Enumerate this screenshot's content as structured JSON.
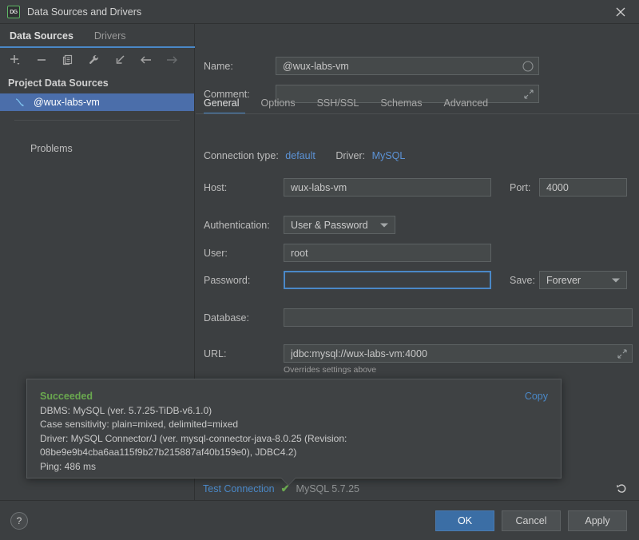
{
  "window": {
    "title": "Data Sources and Drivers",
    "app_icon": "DG",
    "close_label": "✕"
  },
  "left_panel": {
    "tabs": [
      {
        "label": "Data Sources",
        "active": true
      },
      {
        "label": "Drivers",
        "active": false
      }
    ],
    "toolbar": [
      {
        "name": "add-icon",
        "glyph": "+"
      },
      {
        "name": "remove-icon",
        "glyph": "−"
      },
      {
        "name": "duplicate-icon",
        "glyph": "⧉"
      },
      {
        "name": "wrench-icon",
        "glyph": "ὒ7"
      },
      {
        "name": "import-icon",
        "glyph": "↙"
      },
      {
        "name": "back-arrow-icon",
        "glyph": "←"
      },
      {
        "name": "forward-arrow-icon",
        "glyph": "→"
      }
    ],
    "section_title": "Project Data Sources",
    "data_sources": [
      {
        "label": "@wux-labs-vm",
        "selected": true
      }
    ],
    "problems_label": "Problems"
  },
  "form": {
    "name_label": "Name:",
    "name_value": "@wux-labs-vm",
    "comment_label": "Comment:",
    "comment_value": "",
    "tabs": [
      {
        "label": "General",
        "active": true
      },
      {
        "label": "Options",
        "active": false
      },
      {
        "label": "SSH/SSL",
        "active": false
      },
      {
        "label": "Schemas",
        "active": false
      },
      {
        "label": "Advanced",
        "active": false
      }
    ],
    "connection_type_label": "Connection type:",
    "connection_type_value": "default",
    "driver_label": "Driver:",
    "driver_value": "MySQL",
    "host_label": "Host:",
    "host_value": "wux-labs-vm",
    "port_label": "Port:",
    "port_value": "4000",
    "authentication_label": "Authentication:",
    "authentication_value": "User & Password",
    "user_label": "User:",
    "user_value": "root",
    "password_label": "Password:",
    "password_value": "",
    "save_label": "Save:",
    "save_value": "Forever",
    "database_label": "Database:",
    "database_value": "",
    "url_label": "URL:",
    "url_value": "jdbc:mysql://wux-labs-vm:4000",
    "url_hint": "Overrides settings above"
  },
  "result_popup": {
    "status": "Succeeded",
    "copy_label": "Copy",
    "lines": [
      "DBMS: MySQL (ver. 5.7.25-TiDB-v6.1.0)",
      "Case sensitivity: plain=mixed, delimited=mixed",
      "Driver: MySQL Connector/J (ver. mysql-connector-java-8.0.25 (Revision: 08be9e9b4cba6aa115f9b27b215887af40b159e0), JDBC4.2)",
      "Ping: 486 ms"
    ]
  },
  "test_bar": {
    "test_connection_label": "Test Connection",
    "success_check": "✔",
    "db_version": "MySQL 5.7.25",
    "reset_icon": "↶"
  },
  "bottom_bar": {
    "help_label": "?",
    "buttons": [
      {
        "label": "OK",
        "primary": true
      },
      {
        "label": "Cancel",
        "primary": false
      },
      {
        "label": "Apply",
        "primary": false
      }
    ]
  },
  "colors": {
    "window_bg": "#3c3f41",
    "accent_blue": "#4a88c7",
    "selection_blue": "#4b6eaa",
    "success_green": "#6aa84f",
    "link_blue": "#5c93d6",
    "input_bg": "#45494a",
    "primary_button": "#3b6ea5"
  }
}
